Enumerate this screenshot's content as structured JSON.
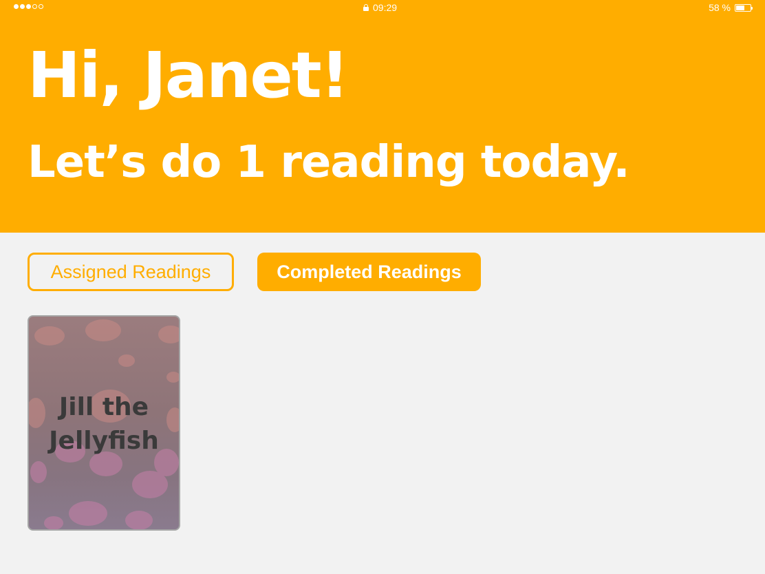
{
  "status_bar": {
    "time": "09:29",
    "battery_label": "58 %",
    "battery_level": 0.58,
    "signal_bars_filled": 3,
    "signal_bars_total": 5
  },
  "header": {
    "greeting": "Hi, Janet!",
    "subtitle": "Let’s do 1 reading today.",
    "background_color": "#ffad00"
  },
  "tabs": [
    {
      "label": "Assigned Readings",
      "active": false
    },
    {
      "label": "Completed Readings",
      "active": true
    }
  ],
  "readings": [
    {
      "title_line1": "Jill the",
      "title_line2": "Jellyfish",
      "cover_icon": "jellyfish-image"
    }
  ]
}
